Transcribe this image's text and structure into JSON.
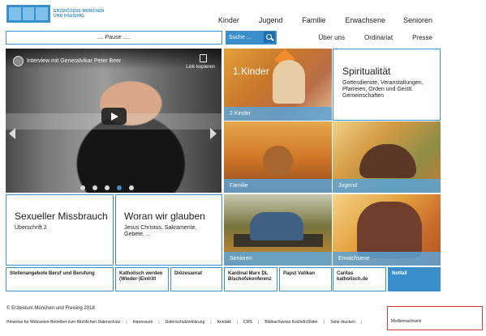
{
  "logo": {
    "text": "ERZDIÖZESE MÜNCHEN UND FREISING"
  },
  "topnav": [
    "Kinder",
    "Jugend",
    "Familie",
    "Erwachsene",
    "Senioren"
  ],
  "search": {
    "pause_text": ".... Pause .....",
    "search_label": "Suche ..."
  },
  "subnav": [
    "Über uns",
    "Ordinariat",
    "Presse"
  ],
  "video": {
    "title": "Interview mit Generalvikar Peter Beer",
    "copy_link": "Link kopieren"
  },
  "tiles": {
    "kinder": {
      "title": "1.Kinder",
      "label": "2 Kinder"
    },
    "spiritualitaet": {
      "title": "Spiritualität",
      "text": "Gottesdienste, Veranstaltungen, Pfarreien, Orden und Geistl. Gemeinschaften"
    },
    "familie": {
      "label": "Familie"
    },
    "jugend": {
      "label": "Jugend"
    },
    "missbrauch": {
      "title": "Sexueller Missbrauch",
      "text": "Überschrift 2"
    },
    "glauben": {
      "title": "Woran wir glauben",
      "text": "Jesus Christus, Sakramente, Gebete, ..."
    },
    "senioren": {
      "label": "Senioren"
    },
    "erwachsene": {
      "label": "Erwachsene"
    }
  },
  "bottom_boxes": [
    "Stellenangebote Beruf und Berufung",
    "Katholisch werden (Wieder-)Eintritt",
    "Diözesanrat",
    "Kardinal Marx DL Bischofskonferenz",
    "Papst Vatikan",
    "Caritas katholisch.de",
    "Notfall"
  ],
  "footer": {
    "copyright": "© Erzbistum München und Freising 2018",
    "links": [
      "Hinweise für Webseiten-Betreiber zum Kirchlichen Datenschutz",
      "Impressum",
      "Datenschutzerklärung",
      "Kontakt",
      "CMS",
      "Bildnachweise Kacheln/Slider",
      "Seite drucken",
      "Mediennachweis"
    ]
  },
  "colors": {
    "accent": "#3a8ec9",
    "highlight": "#d93b3b"
  }
}
